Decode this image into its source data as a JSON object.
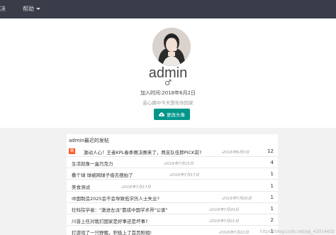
{
  "topbar": {
    "nav_left": "决",
    "nav_help": "帮助"
  },
  "profile": {
    "username": "admin",
    "gender": "♂",
    "joined": "加入时间:2018年6月2日",
    "bio": "芸心路中今天想年你回家",
    "change_avatar_label": "更改头像"
  },
  "posts": {
    "header": "admin最近的发帖",
    "items": [
      {
        "badge": "精",
        "title": "激动人心！王者KPL春季赛决赛来了，两支队伍即PICK前?",
        "date": "-2018年6月3日",
        "count": "12"
      },
      {
        "badge": "",
        "title": "生活就像一盒巧克力",
        "date": "-2018年7月15日",
        "count": "4"
      },
      {
        "badge": "",
        "title": "撒个球 球被网球子借去摆拍了",
        "date": "-2018年7月17日",
        "count": "1"
      },
      {
        "badge": "",
        "title": "美食测试",
        "date": "-2018年7月17日",
        "count": "1"
      },
      {
        "badge": "",
        "title": "中国制造2025会不会导致低学历人士失业?",
        "date": "-2018年7月20日",
        "count": "1"
      },
      {
        "badge": "",
        "title": "社科院学者：\"激进左派\"靠成中国学术界\"公害\"",
        "date": "-2018年7月20日",
        "count": "1"
      },
      {
        "badge": "",
        "title": "川普上任对我们国家是好事还是坏事?",
        "date": "-2018年7月21日",
        "count": "2"
      },
      {
        "badge": "",
        "title": "打游戏了一只野豬，积极上了首页照相!",
        "date": "-2018年7月22日",
        "count": "1"
      }
    ]
  },
  "watermark": "https://blog.csdn.net/qq_41014432",
  "colors": {
    "topbar": "#393d49",
    "accent": "#00968a",
    "badge": "#ff5722"
  }
}
